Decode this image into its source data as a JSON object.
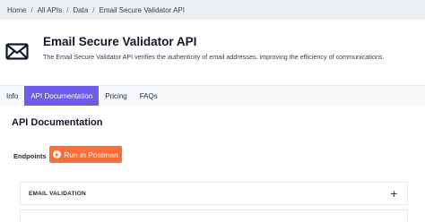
{
  "breadcrumb": {
    "items": [
      "Home",
      "All APIs",
      "Data",
      "Email Secure Validator API"
    ],
    "separator": "/"
  },
  "api": {
    "title": "Email Secure Validator API",
    "description": "The Email Secure Validator API verifies the authenticity of email addresses, improving the efficiency of communications.",
    "icon": "envelope-icon"
  },
  "tabs": [
    {
      "label": "Info",
      "active": false
    },
    {
      "label": "API Documentation",
      "active": true
    },
    {
      "label": "Pricing",
      "active": false
    },
    {
      "label": "FAQs",
      "active": false
    }
  ],
  "documentation": {
    "title": "API Documentation",
    "endpoints_label": "Endpoints",
    "postman_button": "Run in Postman",
    "sections": [
      {
        "title": "EMAIL VALIDATION",
        "expand_icon": "+"
      }
    ]
  },
  "colors": {
    "accent": "#6c5ce7",
    "postman": "#ff6c37"
  }
}
